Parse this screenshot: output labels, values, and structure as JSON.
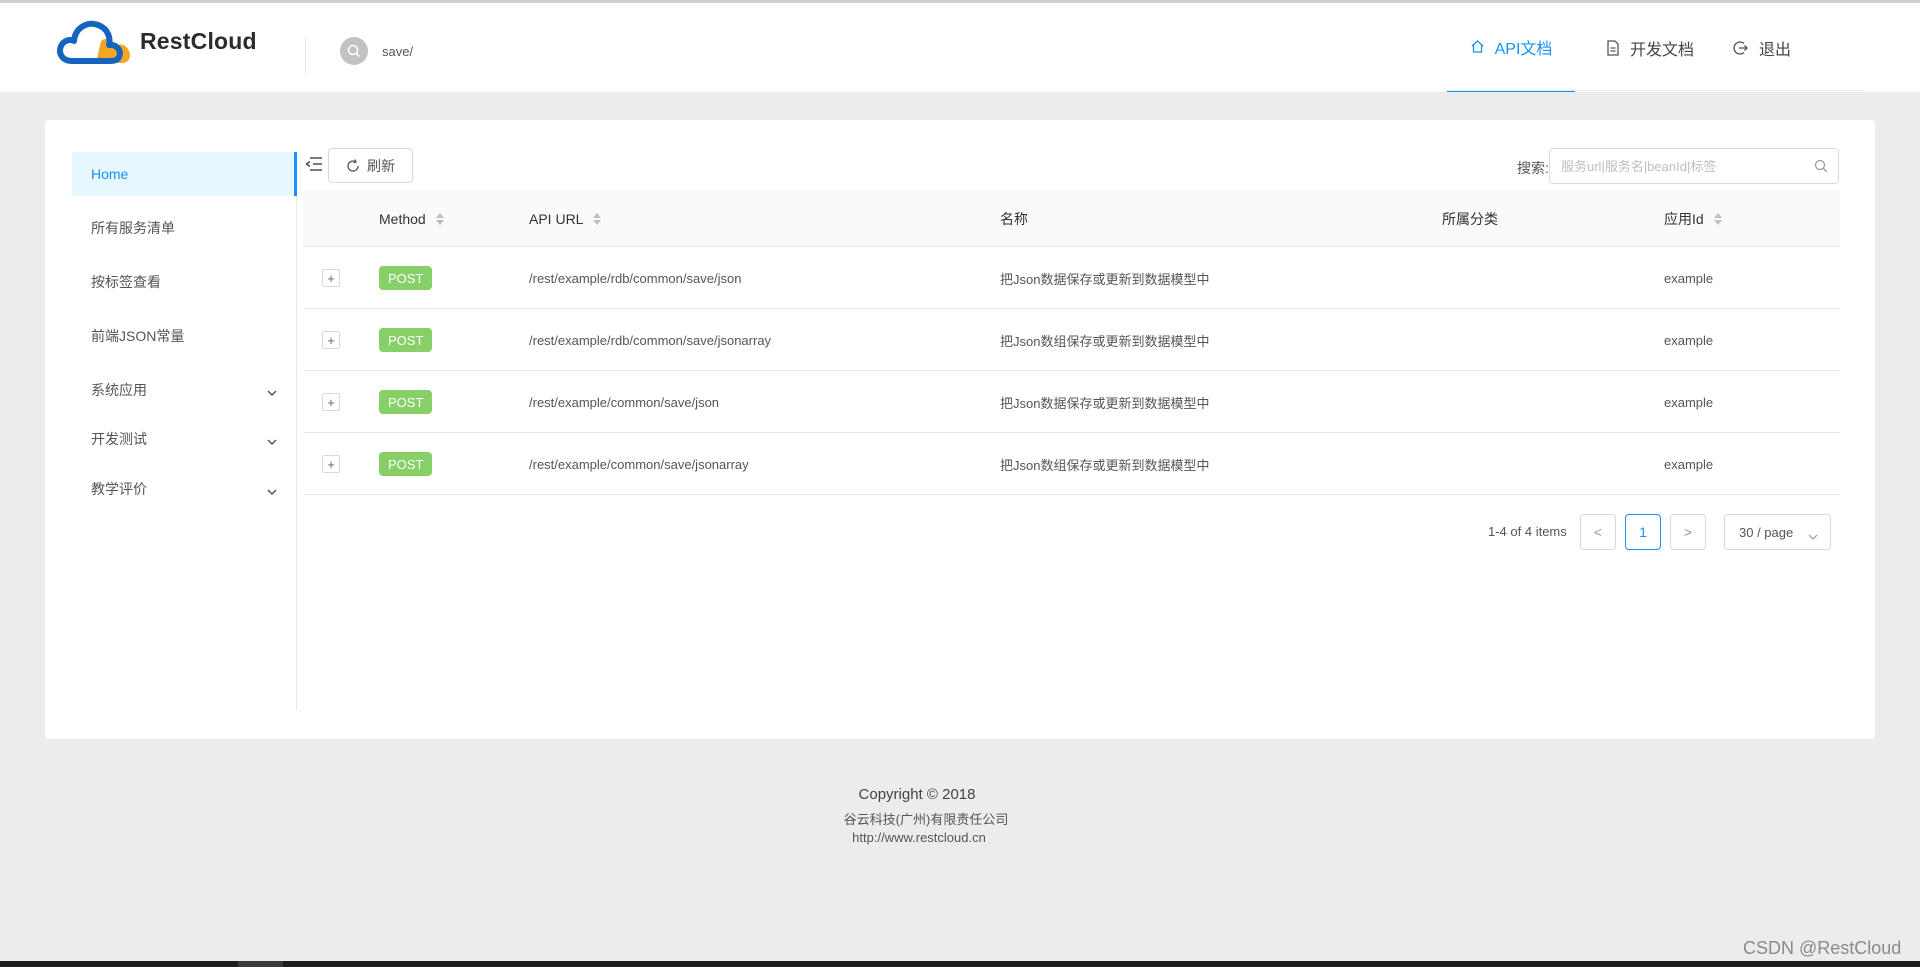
{
  "brand": {
    "name": "RestCloud",
    "logo_colors": [
      "#1565c0",
      "#f5a623"
    ]
  },
  "header": {
    "search_query": "save/",
    "nav": [
      {
        "label": "API文档",
        "icon": "home-icon",
        "active": true
      },
      {
        "label": "开发文档",
        "icon": "document-icon",
        "active": false
      },
      {
        "label": "退出",
        "icon": "logout-icon",
        "active": false
      }
    ]
  },
  "sidebar": {
    "items": [
      {
        "label": "Home",
        "active": true
      },
      {
        "label": "所有服务清单"
      },
      {
        "label": "按标签查看"
      },
      {
        "label": "前端JSON常量"
      },
      {
        "label": "系统应用",
        "submenu": true
      },
      {
        "label": "开发测试",
        "submenu": true
      },
      {
        "label": "教学评价",
        "submenu": true
      }
    ]
  },
  "toolbar": {
    "refresh_label": "刷新",
    "search_label": "搜索:",
    "search_placeholder": "服务url|服务名|beanId|标签"
  },
  "table": {
    "columns": [
      "Method",
      "API URL",
      "名称",
      "所属分类",
      "应用Id"
    ],
    "rows": [
      {
        "method": "POST",
        "url": "/rest/example/rdb/common/save/json",
        "name": "把Json数据保存或更新到数据模型中",
        "category": "",
        "app_id": "example"
      },
      {
        "method": "POST",
        "url": "/rest/example/rdb/common/save/jsonarray",
        "name": "把Json数组保存或更新到数据模型中",
        "category": "",
        "app_id": "example"
      },
      {
        "method": "POST",
        "url": "/rest/example/common/save/json",
        "name": "把Json数据保存或更新到数据模型中",
        "category": "",
        "app_id": "example"
      },
      {
        "method": "POST",
        "url": "/rest/example/common/save/jsonarray",
        "name": "把Json数组保存或更新到数据模型中",
        "category": "",
        "app_id": "example"
      }
    ]
  },
  "pagination": {
    "total_text": "1-4 of 4 items",
    "prev": "<",
    "current_page": "1",
    "next": ">",
    "page_size": "30 / page"
  },
  "footer": {
    "copyright": "Copyright © 2018",
    "company": "谷云科技(广州)有限责任公司",
    "website": "http://www.restcloud.cn"
  },
  "watermark": "CSDN @RestCloud",
  "colors": {
    "accent": "#1890ff",
    "post_tag": "#87d068",
    "page_bg": "#ececec"
  }
}
